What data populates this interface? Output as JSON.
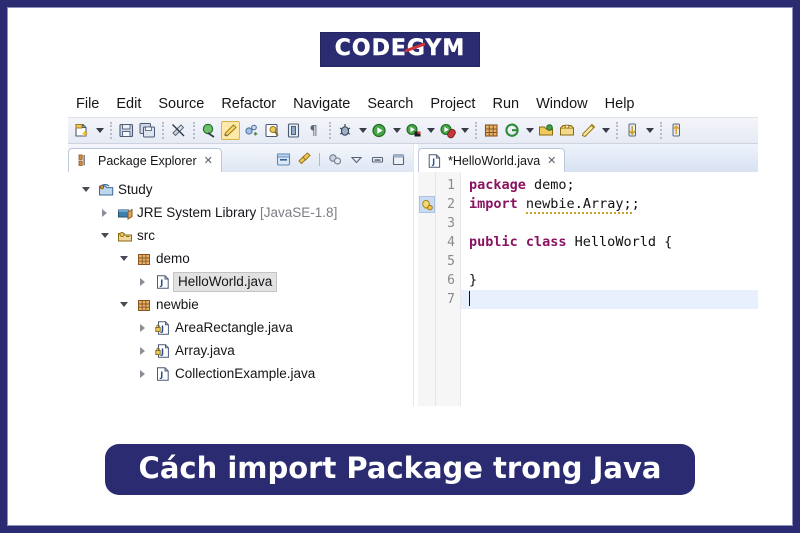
{
  "brand": {
    "logo_text": "CODEGYM",
    "logo_bg": "#2b2b72",
    "logo_accent": "#cf3333"
  },
  "menubar": {
    "items": [
      {
        "label": "File"
      },
      {
        "label": "Edit"
      },
      {
        "label": "Source"
      },
      {
        "label": "Refactor"
      },
      {
        "label": "Navigate"
      },
      {
        "label": "Search"
      },
      {
        "label": "Project"
      },
      {
        "label": "Run"
      },
      {
        "label": "Window"
      },
      {
        "label": "Help"
      }
    ]
  },
  "toolbar": {
    "items": [
      {
        "icon": "new-file-icon"
      },
      {
        "icon": "dropdown-arrow-icon"
      },
      {
        "icon": "save-icon"
      },
      {
        "icon": "save-all-icon"
      },
      {
        "icon": "no-link-icon"
      },
      {
        "icon": "debug-skip-breakpoints-icon"
      },
      {
        "icon": "highlight-pen-icon",
        "active": true
      },
      {
        "icon": "toggle-mark-occurrences-icon"
      },
      {
        "icon": "open-type-icon"
      },
      {
        "icon": "open-task-icon"
      },
      {
        "icon": "show-whitespace-icon"
      },
      {
        "icon": "debug-icon"
      },
      {
        "icon": "dropdown-arrow-icon"
      },
      {
        "icon": "run-icon"
      },
      {
        "icon": "dropdown-arrow-icon"
      },
      {
        "icon": "coverage-icon"
      },
      {
        "icon": "dropdown-arrow-icon"
      },
      {
        "icon": "external-tools-icon"
      },
      {
        "icon": "dropdown-arrow-icon"
      },
      {
        "icon": "new-package-icon"
      },
      {
        "icon": "new-class-icon"
      },
      {
        "icon": "dropdown-arrow-icon"
      },
      {
        "icon": "open-folder-icon"
      },
      {
        "icon": "archive-icon"
      },
      {
        "icon": "search-pen-icon"
      },
      {
        "icon": "dropdown-arrow-icon"
      },
      {
        "icon": "previous-annotation-icon"
      },
      {
        "icon": "dropdown-arrow-icon"
      },
      {
        "icon": "next-annotation-icon"
      }
    ]
  },
  "package_explorer": {
    "tab_label": "Package Explorer",
    "tab_close": "✕",
    "tools": [
      {
        "icon": "collapse-all-icon"
      },
      {
        "icon": "link-with-editor-icon"
      },
      {
        "icon": "view-filter-icon"
      },
      {
        "icon": "view-menu-icon"
      },
      {
        "icon": "minimize-icon"
      },
      {
        "icon": "maximize-icon"
      }
    ],
    "tree": [
      {
        "label": "Study",
        "indent": 0,
        "twisty": "open",
        "icon": "java-project-icon",
        "selected": false,
        "suffix": ""
      },
      {
        "label": "JRE System Library",
        "indent": 1,
        "twisty": "closed",
        "icon": "library-icon",
        "selected": false,
        "suffix": " [JavaSE-1.8]"
      },
      {
        "label": "src",
        "indent": 1,
        "twisty": "open",
        "icon": "source-folder-icon",
        "selected": false,
        "suffix": ""
      },
      {
        "label": "demo",
        "indent": 2,
        "twisty": "open",
        "icon": "package-icon",
        "selected": false,
        "suffix": ""
      },
      {
        "label": "HelloWorld.java",
        "indent": 3,
        "twisty": "closed",
        "icon": "java-file-icon",
        "selected": true,
        "suffix": ""
      },
      {
        "label": "newbie",
        "indent": 2,
        "twisty": "open",
        "icon": "package-icon",
        "selected": false,
        "suffix": ""
      },
      {
        "label": "AreaRectangle.java",
        "indent": 3,
        "twisty": "closed",
        "icon": "java-file-package-icon",
        "selected": false,
        "suffix": ""
      },
      {
        "label": "Array.java",
        "indent": 3,
        "twisty": "closed",
        "icon": "java-file-package-icon",
        "selected": false,
        "suffix": ""
      },
      {
        "label": "CollectionExample.java",
        "indent": 3,
        "twisty": "closed",
        "icon": "java-file-icon",
        "selected": false,
        "suffix": ""
      }
    ]
  },
  "editor": {
    "tab_label": "*HelloWorld.java",
    "tab_close": "✕",
    "tab_icon": "java-file-icon",
    "marker_icon": "quick-fix-warning-icon",
    "marker_line": 2,
    "current_line": 7,
    "line_numbers": [
      "1",
      "2",
      "3",
      "4",
      "5",
      "6",
      "7"
    ],
    "lines": [
      {
        "n": "1",
        "tokens": [
          {
            "t": "package",
            "k": "kw"
          },
          {
            "t": " demo;",
            "k": ""
          }
        ]
      },
      {
        "n": "2",
        "tokens": [
          {
            "t": "import",
            "k": "kw"
          },
          {
            "t": " ",
            "k": ""
          },
          {
            "t": "newbie.Array;",
            "k": "warn"
          },
          {
            "t": ";",
            "k": ""
          }
        ]
      },
      {
        "n": "3",
        "tokens": [
          {
            "t": "",
            "k": ""
          }
        ]
      },
      {
        "n": "4",
        "tokens": [
          {
            "t": "public class",
            "k": "kw"
          },
          {
            "t": " HelloWorld {",
            "k": ""
          }
        ]
      },
      {
        "n": "5",
        "tokens": [
          {
            "t": "",
            "k": ""
          }
        ]
      },
      {
        "n": "6",
        "tokens": [
          {
            "t": "}",
            "k": ""
          }
        ]
      },
      {
        "n": "7",
        "tokens": [
          {
            "t": "",
            "k": ""
          }
        ]
      }
    ]
  },
  "banner": {
    "text": "Cách import Package trong Java",
    "bg": "#2b2b72",
    "fg": "#ffffff"
  }
}
